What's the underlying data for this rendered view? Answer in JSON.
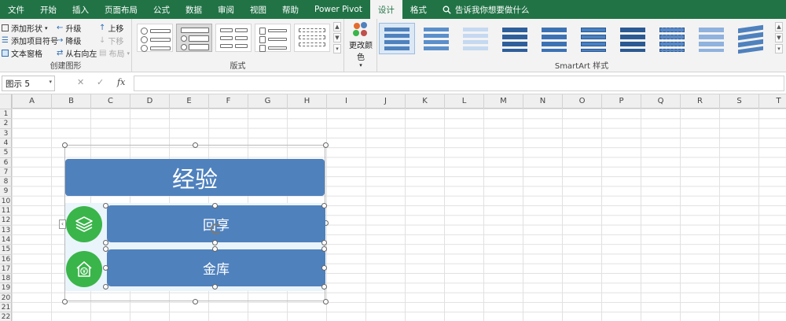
{
  "tabs": [
    "文件",
    "开始",
    "插入",
    "页面布局",
    "公式",
    "数据",
    "审阅",
    "视图",
    "帮助",
    "Power Pivot",
    "设计",
    "格式"
  ],
  "active_tab": "设计",
  "tell_me": "告诉我你想要做什么",
  "ribbon": {
    "create_group": {
      "label": "创建图形",
      "add_shape": "添加形状",
      "add_bullet": "添加项目符号",
      "text_pane": "文本窗格",
      "promote": "升级",
      "demote": "降级",
      "right_to_left": "从右向左",
      "move_up": "上移",
      "move_down": "下移",
      "layout": "布局"
    },
    "layouts_group": {
      "label": "版式"
    },
    "colors_group": {
      "change_colors": "更改颜色"
    },
    "styles_group": {
      "label": "SmartArt 样式"
    }
  },
  "formula_bar": {
    "name_box": "图示 5",
    "fx": "fx"
  },
  "columns": [
    "A",
    "B",
    "C",
    "D",
    "E",
    "F",
    "G",
    "H",
    "I",
    "J",
    "K",
    "L",
    "M",
    "N",
    "O",
    "P",
    "Q",
    "R",
    "S",
    "T"
  ],
  "rows": [
    "1",
    "2",
    "3",
    "4",
    "5",
    "6",
    "7",
    "8",
    "9",
    "10",
    "11",
    "12",
    "13",
    "14",
    "15",
    "16",
    "17",
    "18",
    "19",
    "20",
    "21",
    "22"
  ],
  "smartart": {
    "title": "经验",
    "items": [
      {
        "text": "回享",
        "icon": "stack-layers-icon"
      },
      {
        "text": "金库",
        "icon": "yen-house-icon"
      }
    ],
    "colors": {
      "box": "#4f81bd",
      "circle": "#3ab54a"
    }
  }
}
